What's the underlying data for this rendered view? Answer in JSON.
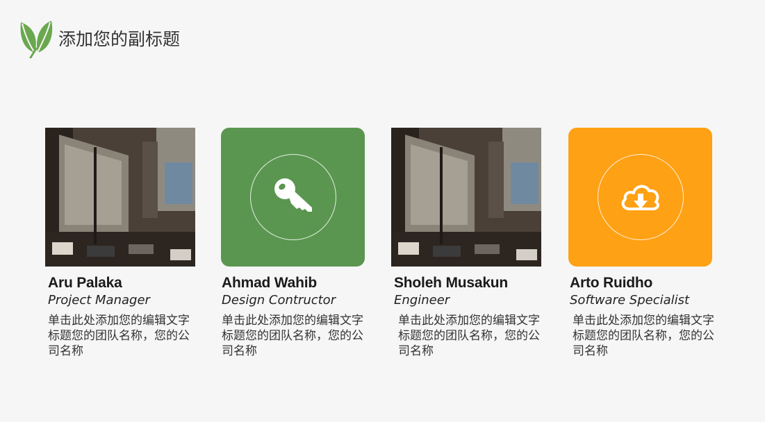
{
  "header": {
    "title": "添加您的副标题",
    "logo_icon": "leaf-icon",
    "accent": "#6aa84f"
  },
  "cards": [
    {
      "media": "city-street-photo",
      "name": "Aru Palaka",
      "role": "Project Manager",
      "desc": "单击此处添加您的编辑文字标题您的团队名称，您的公司名称"
    },
    {
      "media": "tile",
      "tile_color": "#5a9650",
      "icon": "key-icon",
      "name": "Ahmad Wahib",
      "role": "Design Contructor",
      "desc": "单击此处添加您的编辑文字标题您的团队名称，您的公司名称"
    },
    {
      "media": "city-street-photo",
      "name": "Sholeh Musakun",
      "role": "Engineer",
      "desc": "单击此处添加您的编辑文字标题您的团队名称，您的公司名称"
    },
    {
      "media": "tile",
      "tile_color": "#ffa114",
      "icon": "cloud-download-icon",
      "name": "Arto Ruidho",
      "role": "Software Specialist",
      "desc": "单击此处添加您的编辑文字标题您的团队名称，您的公司名称"
    }
  ]
}
